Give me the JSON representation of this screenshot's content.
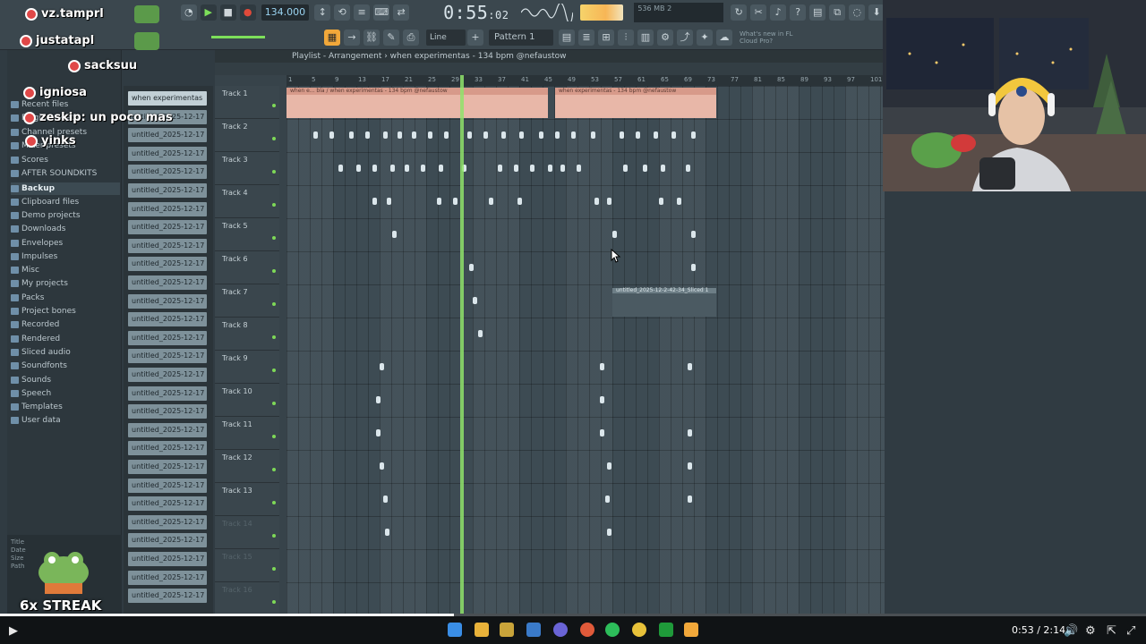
{
  "toolbar": {
    "tempo": "134.000",
    "time_main": "0:55",
    "time_sub": ":02",
    "cpu": "536 MB\n2",
    "pattern": "Pattern 1",
    "line_mode": "Line",
    "news": "What's new in FL Cloud Pro?"
  },
  "browser": {
    "items": [
      "Recent files",
      "Plugin presets",
      "Channel presets",
      "Mixer presets",
      "Scores",
      "AFTER SOUNDKITS",
      "Backup",
      "Clipboard files",
      "Demo projects",
      "Downloads",
      "Envelopes",
      "Impulses",
      "Misc",
      "My projects",
      "Packs",
      "Project bones",
      "Recorded",
      "Rendered",
      "Sliced audio",
      "Soundfonts",
      "Sounds",
      "Speech",
      "Templates",
      "User data"
    ],
    "selected": "Backup",
    "info": "Title\nDate\nSize\nPath"
  },
  "clips": {
    "first": "when experimentas",
    "item": "untitled_2025-12-17 02 -"
  },
  "playlist": {
    "title": "Playlist - Arrangement › when experimentas - 134 bpm @nefaustow",
    "tracks": [
      "Track 1",
      "Track 2",
      "Track 3",
      "Track 4",
      "Track 5",
      "Track 6",
      "Track 7",
      "Track 8",
      "Track 9",
      "Track 10",
      "Track 11",
      "Track 12",
      "Track 13",
      "Track 14",
      "Track 15",
      "Track 16"
    ],
    "ruler": [
      "1",
      "5",
      "9",
      "13",
      "17",
      "21",
      "25",
      "29",
      "33",
      "37",
      "41",
      "45",
      "49",
      "53",
      "57",
      "61",
      "65",
      "69",
      "73",
      "77",
      "81",
      "85",
      "89",
      "93",
      "97",
      "101"
    ],
    "audio_clip_1": "when e... bla / when experimentas - 134 bpm @nefaustow",
    "audio_clip_2": "when experimentas - 134 bpm @nefaustow",
    "audio_clip_3": "untitled_2025-12-2-42-34_Sliced 1"
  },
  "chat": {
    "lines": [
      "vz.tamprl",
      "justatapl",
      "sacksuu",
      "igniosa",
      "zeskip: un poco mas",
      "yinks"
    ]
  },
  "streak": "6x STREAK",
  "player": {
    "time": "0:53 / 2:14",
    "progress": 0.396,
    "accent": "#ffffff"
  }
}
